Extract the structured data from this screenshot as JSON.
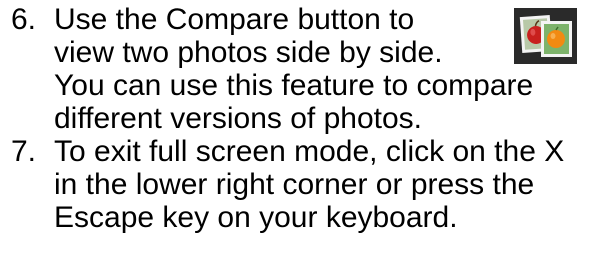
{
  "steps": [
    {
      "number": "6.",
      "lines": [
        "Use the Compare button to",
        "view two photos side by side.",
        "You can use this feature to compare",
        "different versions of photos."
      ]
    },
    {
      "number": "7.",
      "lines": [
        "To exit full screen mode, click on the X",
        "in the lower right corner or press the",
        "Escape key on your keyboard."
      ]
    }
  ],
  "compare_icon": {
    "icon": "compare-photos-icon",
    "colors": {
      "background": "#2a2a2a",
      "photo_frame": "#f4f4f4",
      "left_photo": "#b8c9a8",
      "right_photo": "#7db36b",
      "apple": "#c8201e",
      "orange": "#f28a12"
    }
  }
}
